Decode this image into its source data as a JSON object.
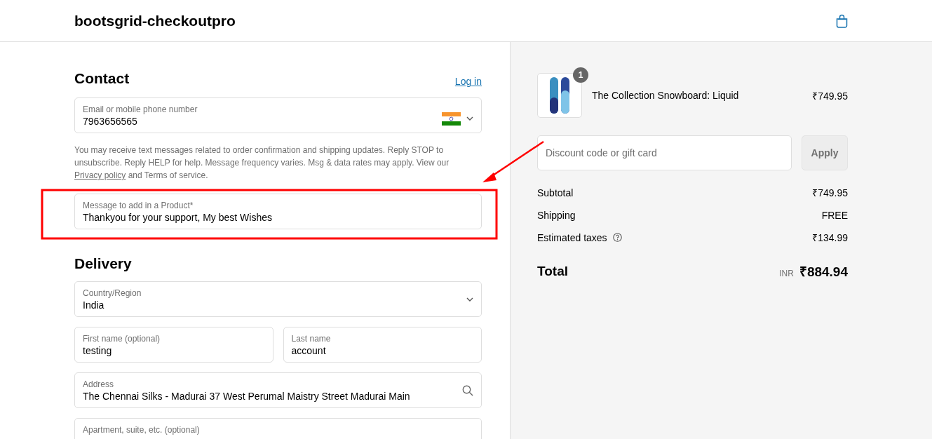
{
  "header": {
    "brand": "bootsgrid-checkoutpro"
  },
  "contact": {
    "heading": "Contact",
    "login_link": "Log in",
    "phone_field": {
      "label": "Email or mobile phone number",
      "value": "7963656565"
    },
    "consent": {
      "text_before": "You may receive text messages related to order confirmation and shipping updates. Reply STOP to unsubscribe. Reply HELP for help. Message frequency varies. Msg & data rates may apply. View our",
      "link": "Privacy policy",
      "text_after": "and Terms of service."
    },
    "message_field": {
      "label": "Message to add in a Product*",
      "value": "Thankyou for your support, My best Wishes"
    }
  },
  "delivery": {
    "heading": "Delivery",
    "rows": [
      [
        {
          "kind": "select",
          "label": "Country/Region",
          "value": "India"
        }
      ],
      [
        {
          "kind": "text",
          "label": "First name (optional)",
          "value": "testing"
        },
        {
          "kind": "text",
          "label": "Last name",
          "value": "account"
        }
      ],
      [
        {
          "kind": "search",
          "label": "Address",
          "value": "The Chennai Silks - Madurai 37 West Perumal Maistry Street Madurai Main"
        }
      ],
      [
        {
          "kind": "text",
          "label": "Apartment, suite, etc. (optional)"
        }
      ]
    ]
  },
  "summary": {
    "product": {
      "name": "The Collection Snowboard: Liquid",
      "price": "₹749.95",
      "quantity": "1"
    },
    "discount": {
      "placeholder": "Discount code or gift card",
      "button": "Apply"
    },
    "lines": [
      {
        "label": "Subtotal",
        "value": "₹749.95",
        "help_icon": false
      },
      {
        "label": "Shipping",
        "value": "FREE",
        "help_icon": false
      },
      {
        "label": "Estimated taxes",
        "value": "₹134.99",
        "help_icon": true
      }
    ],
    "total": {
      "label": "Total",
      "currency": "INR",
      "value": "₹884.94"
    }
  }
}
